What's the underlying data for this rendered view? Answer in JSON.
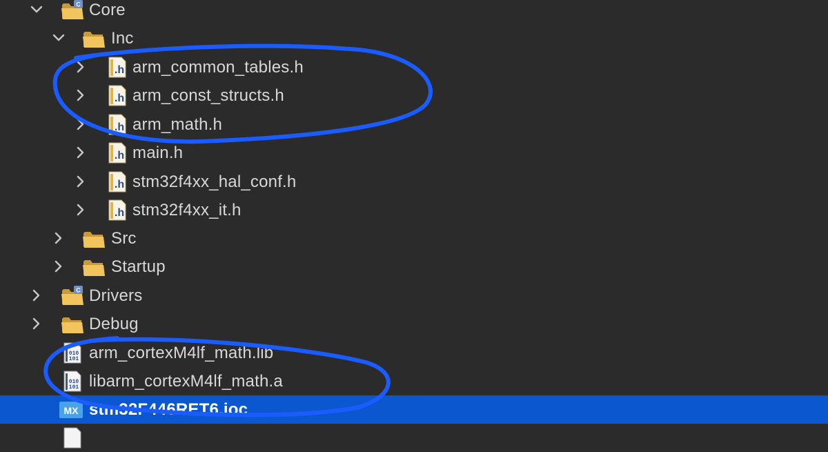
{
  "colors": {
    "background": "#2b2b2b",
    "text": "#d8d8d8",
    "selection": "#0a57d0",
    "annotation": "#1a5cff"
  },
  "tree": {
    "items": [
      {
        "label": "Core",
        "icon": "source-folder-icon",
        "chevron": "expanded"
      },
      {
        "label": "Inc",
        "icon": "folder-icon",
        "chevron": "expanded"
      },
      {
        "label": "arm_common_tables.h",
        "icon": "header-file-icon",
        "chevron": "collapsed"
      },
      {
        "label": "arm_const_structs.h",
        "icon": "header-file-icon",
        "chevron": "collapsed"
      },
      {
        "label": "arm_math.h",
        "icon": "header-file-icon",
        "chevron": "collapsed"
      },
      {
        "label": "main.h",
        "icon": "header-file-icon",
        "chevron": "collapsed"
      },
      {
        "label": "stm32f4xx_hal_conf.h",
        "icon": "header-file-icon",
        "chevron": "collapsed"
      },
      {
        "label": "stm32f4xx_it.h",
        "icon": "header-file-icon",
        "chevron": "collapsed"
      },
      {
        "label": "Src",
        "icon": "folder-icon",
        "chevron": "collapsed"
      },
      {
        "label": "Startup",
        "icon": "folder-icon",
        "chevron": "collapsed"
      },
      {
        "label": "Drivers",
        "icon": "source-folder-icon",
        "chevron": "collapsed"
      },
      {
        "label": "Debug",
        "icon": "folder-icon",
        "chevron": "collapsed"
      },
      {
        "label": "arm_cortexM4lf_math.lib",
        "icon": "binary-file-icon",
        "chevron": "none"
      },
      {
        "label": "libarm_cortexM4lf_math.a",
        "icon": "binary-file-icon",
        "chevron": "none"
      },
      {
        "label": "stm32F446RET6.ioc",
        "icon": "cubemx-ioc-icon",
        "icon_text": "MX",
        "chevron": "none",
        "selected": true
      }
    ]
  }
}
